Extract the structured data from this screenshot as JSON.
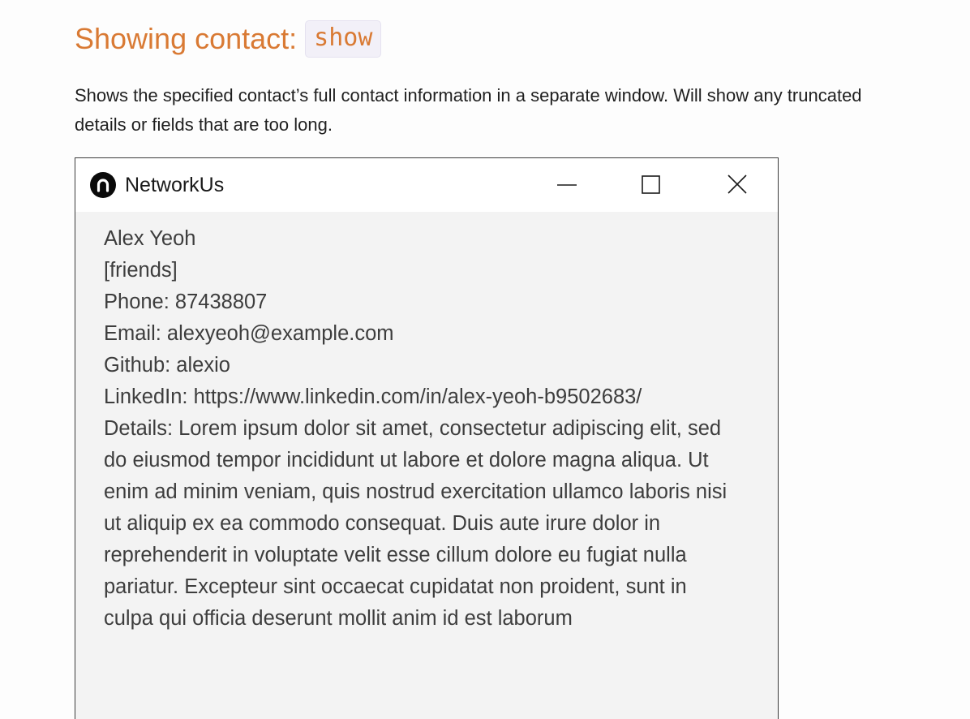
{
  "doc": {
    "heading_text": "Showing contact:",
    "heading_code": "show",
    "description": "Shows the specified contact’s full contact information in a separate window. Will show any truncated details or fields that are too long."
  },
  "window": {
    "app_title": "NetworkUs",
    "icons": {
      "app": "networkus-logo-icon",
      "minimize": "minimize-icon",
      "maximize": "maximize-icon",
      "close": "close-icon"
    }
  },
  "contact": {
    "name": "Alex Yeoh",
    "tags": "[friends]",
    "phone": "Phone: 87438807",
    "email": "Email: alexyeoh@example.com",
    "github": "Github: alexio",
    "linkedin": "LinkedIn: https://www.linkedin.com/in/alex-yeoh-b9502683/",
    "details": [
      "Details: Lorem ipsum dolor sit amet, consectetur adipiscing elit, sed",
      "do eiusmod tempor incididunt ut labore et dolore magna aliqua. Ut",
      "enim ad minim veniam, quis nostrud exercitation ullamco laboris nisi",
      "ut aliquip ex ea commodo consequat. Duis aute irure dolor in",
      "reprehenderit in voluptate velit esse cillum dolore eu fugiat nulla",
      "pariatur. Excepteur sint occaecat cupidatat non proident, sunt in",
      "culpa qui officia deserunt mollit anim id est laborum"
    ]
  },
  "colors": {
    "heading": "#d97a34",
    "code_chip_bg": "#f2f0f8",
    "window_bg": "#f3f3f3",
    "titlebar_bg": "#ffffff",
    "content_text": "#3d3d3d"
  }
}
